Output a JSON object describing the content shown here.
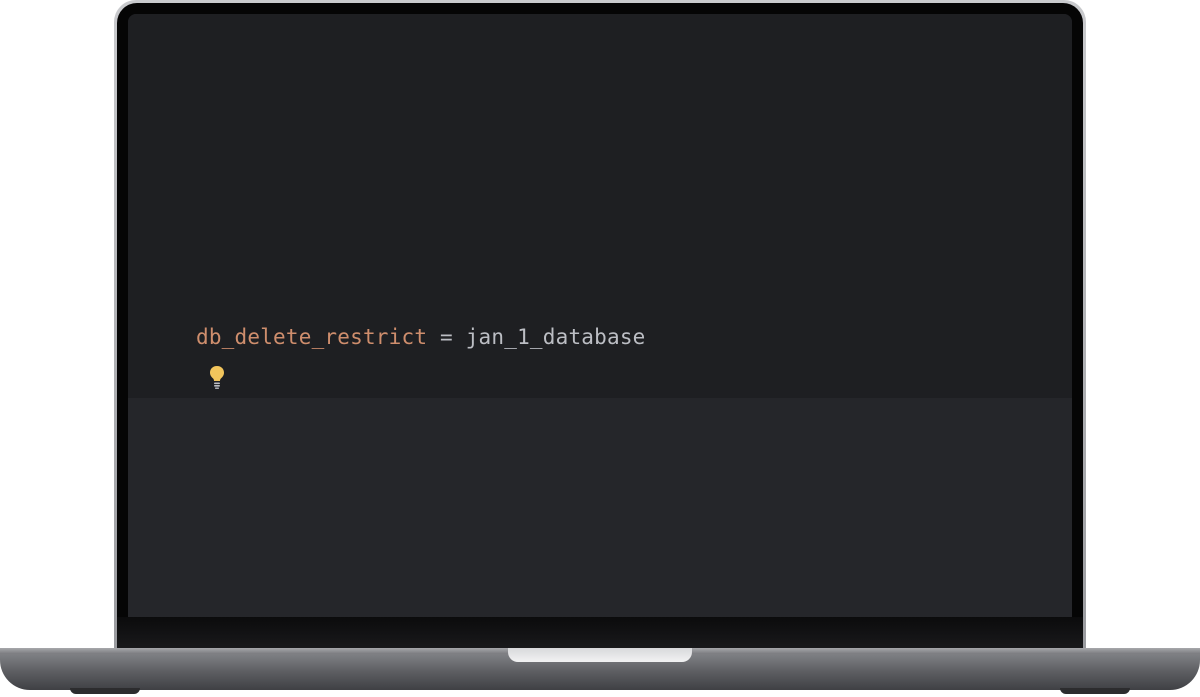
{
  "editor": {
    "code_line": {
      "variable": "db_delete_restrict",
      "operator": "=",
      "value": "jan_1_database"
    },
    "intention_icon": "lightbulb-icon"
  },
  "colors": {
    "editor_background": "#1e1f22",
    "editor_lower_background": "#25262a",
    "variable_color": "#cf8e6d",
    "text_color": "#bcbec4",
    "bulb_color": "#f2c55c"
  }
}
